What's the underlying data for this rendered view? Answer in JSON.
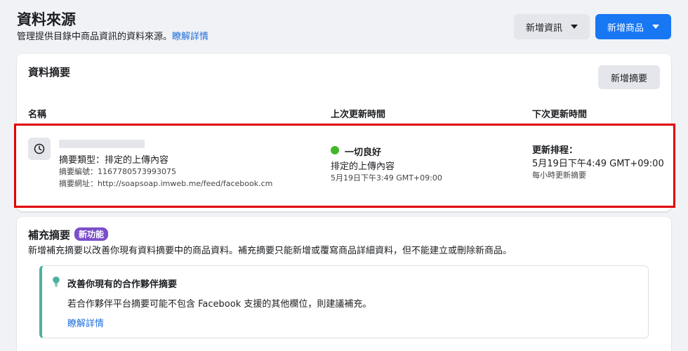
{
  "header": {
    "title": "資料來源",
    "description": "管理提供目錄中商品資訊的資料來源。",
    "learn_more": "瞭解詳情",
    "add_data_label": "新增資訊",
    "add_product_label": "新增商品"
  },
  "feeds_section": {
    "title": "資料摘要",
    "add_feed_label": "新增摘要",
    "columns": [
      "名稱",
      "上次更新時間",
      "下次更新時間"
    ],
    "feed": {
      "type": "摘要類型：排定的上傳內容",
      "id": "摘要編號：1167780573993075",
      "url": "摘要網址：http://soapsoap.imweb.me/feed/facebook.cm",
      "status": "一切良好",
      "last_method": "排定的上傳內容",
      "last_time": "5月19日下午3:49 GMT+09:00",
      "next_label": "更新排程：",
      "next_time": "5月19日下午4:49 GMT+09:00",
      "frequency": "每小時更新摘要"
    }
  },
  "supplement_section": {
    "title": "補充摘要",
    "badge": "新功能",
    "description": "新增補充摘要以改善你現有資料摘要中的商品資料。補充摘要只能新增或覆寫商品詳細資料，但不能建立或刪除新商品。",
    "tip_title": "改善你現有的合作夥伴摘要",
    "tip_body": "若合作夥伴平台摘要可能不包含 Facebook 支援的其他欄位，則建議補充。",
    "tip_link": "瞭解詳情"
  },
  "colors": {
    "accent": "#1877f2",
    "link": "#216fdb",
    "status_ok": "#42b72a",
    "highlight": "#e00000",
    "badge": "#7b4ecb",
    "tip_border": "#4cb1a0"
  },
  "icons": [
    "clock-icon",
    "lightbulb-icon",
    "caret-down-icon"
  ]
}
